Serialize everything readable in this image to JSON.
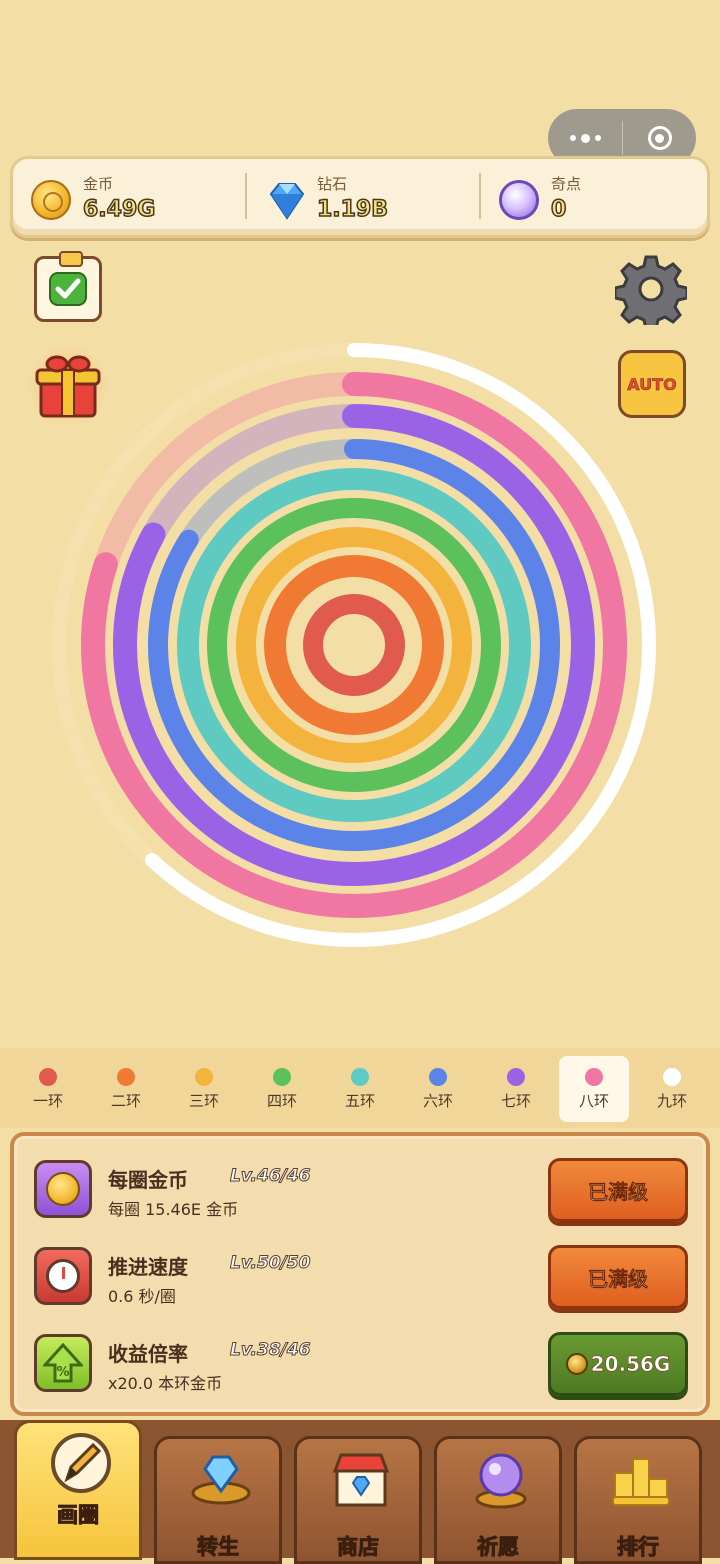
{
  "capsule": {
    "more_icon": "dots-icon",
    "close_icon": "target-icon"
  },
  "currencies": [
    {
      "label": "金币",
      "value": "6.49G",
      "icon": "coin-icon"
    },
    {
      "label": "钻石",
      "value": "1.19B",
      "icon": "diamond-icon"
    },
    {
      "label": "奇点",
      "value": "0",
      "icon": "orb-icon"
    }
  ],
  "side_buttons": {
    "auto_label": "AUTO"
  },
  "rings_progress": [
    1.0,
    1.0,
    1.0,
    1.0,
    1.0,
    0.84,
    0.83,
    0.8,
    0.62
  ],
  "ring_tabs": [
    {
      "name": "一环",
      "color": "#e05a4e"
    },
    {
      "name": "二环",
      "color": "#f07a33"
    },
    {
      "name": "三环",
      "color": "#f4b33c"
    },
    {
      "name": "四环",
      "color": "#5cc15c"
    },
    {
      "name": "五环",
      "color": "#5fcac2"
    },
    {
      "name": "六环",
      "color": "#5b83e8"
    },
    {
      "name": "七环",
      "color": "#9a63e6"
    },
    {
      "name": "八环",
      "color": "#ef77a2"
    },
    {
      "name": "九环",
      "color": "#ffffff"
    }
  ],
  "active_ring": "八环",
  "upgrades": [
    {
      "title": "每圈金币",
      "level": "Lv.46/46",
      "desc": "每圈 15.46E 金币",
      "button": "已满级"
    },
    {
      "title": "推进速度",
      "level": "Lv.50/50",
      "desc": "0.6 秒/圈",
      "button": "已满级"
    },
    {
      "title": "收益倍率",
      "level": "Lv.38/46",
      "desc": "x20.0 本环金币",
      "button": "20.56G"
    }
  ],
  "nav": [
    {
      "label": "画圈",
      "icon": "pencil-icon"
    },
    {
      "label": "转生",
      "icon": "rebirth-gem-icon"
    },
    {
      "label": "商店",
      "icon": "shop-icon"
    },
    {
      "label": "祈愿",
      "icon": "crystal-ball-icon"
    },
    {
      "label": "排行",
      "icon": "podium-icon"
    }
  ]
}
